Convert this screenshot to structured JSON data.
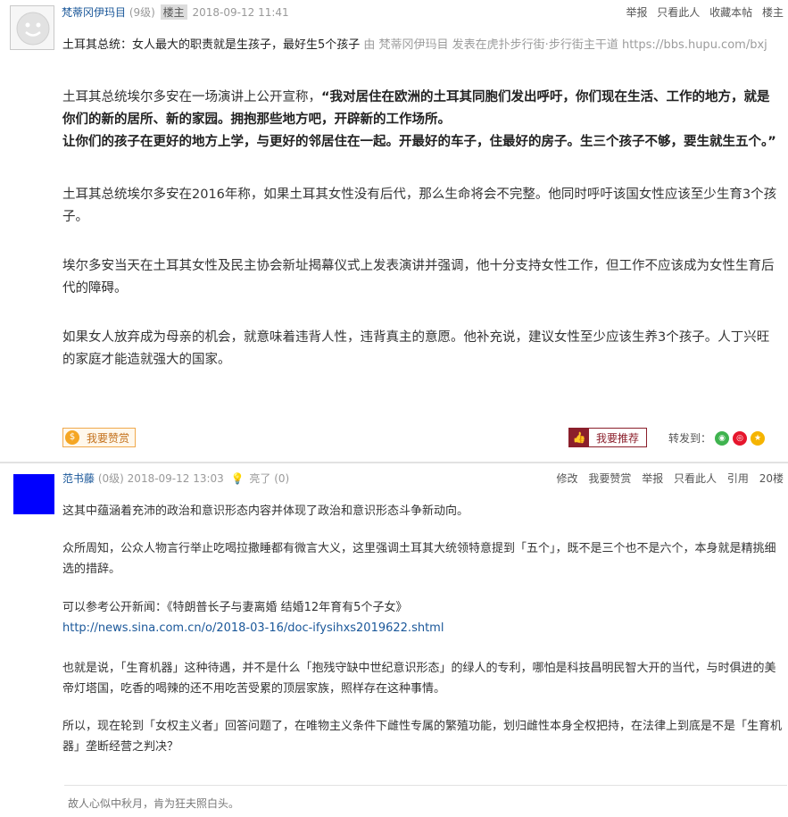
{
  "post1": {
    "username": "梵蒂冈伊玛目",
    "level": "(9级)",
    "badge": "楼主",
    "time": "2018-09-12 11:41",
    "actions": [
      "举报",
      "只看此人",
      "收藏本帖",
      "楼主"
    ],
    "title": "土耳其总统：女人最大的职责就是生孩子，最好生5个孩子",
    "source": "由 梵蒂冈伊玛目 发表在虎扑步行街·步行街主干道 https://bbs.hupu.com/bxj",
    "intro": "土耳其总统埃尔多安在一场演讲上公开宣称，",
    "quote_line1": "“我对居住在欧洲的土耳其同胞们发出呼吁，你们现在生活、工作的地方，就是你们的新的居所、新的家园。拥抱那些地方吧，开辟新的工作场所。",
    "quote_line2": "让你们的孩子在更好的地方上学，与更好的邻居住在一起。开最好的车子，住最好的房子。生三个孩子不够，要生就生五个。”",
    "para2": "土耳其总统埃尔多安在2016年称，如果土耳其女性没有后代，那么生命将会不完整。他同时呼吁该国女性应该至少生育3个孩子。",
    "para3": "埃尔多安当天在土耳其女性及民主协会新址揭幕仪式上发表演讲并强调，他十分支持女性工作，但工作不应该成为女性生育后代的障碍。",
    "para4": "如果女人放弃成为母亲的机会，就意味着违背人性，违背真主的意愿。他补充说，建议女性至少应该生养3个孩子。人丁兴旺的家庭才能造就强大的国家。",
    "zan_label": "我要赞赏",
    "tui_label": "我要推荐",
    "share_label": "转发到："
  },
  "post2": {
    "username": "范书藤",
    "level": "(0级)",
    "time": "2018-09-12 13:03",
    "liang": "亮了 (0)",
    "actions": [
      "修改",
      "我要赞赏",
      "举报",
      "只看此人",
      "引用",
      "20楼"
    ],
    "para1": "这其中蕴涵着充沛的政治和意识形态内容并体现了政治和意识形态斗争新动向。",
    "para2": "众所周知，公众人物言行举止吃喝拉撒睡都有微言大义，这里强调土耳其大统领特意提到「五个」，既不是三个也不是六个，本身就是精挑细选的措辞。",
    "para3": "可以参考公开新闻：《特朗普长子与妻离婚 结婚12年育有5个子女》",
    "link": "http://news.sina.com.cn/o/2018-03-16/doc-ifysihxs2019622.shtml",
    "para4": "也就是说，「生育机器」这种待遇，并不是什么「抱残守缺中世纪意识形态」的绿人的专利，哪怕是科技昌明民智大开的当代，与时俱进的美帝灯塔国，吃香的喝辣的还不用吃苦受累的顶层家族，照样存在这种事情。",
    "para5": "所以，现在轮到「女权主义者」回答问题了，在唯物主义条件下雌性专属的繁殖功能，划归雌性本身全权把持，在法律上到底是不是「生育机器」垄断经营之判决？",
    "signature": "故人心似中秋月，肯为狂夫照白头。"
  },
  "colors": {
    "link": "#1a5799",
    "avatar2": "#0000ff",
    "recommend": "#8b1f2b",
    "reward": "#f5a623"
  },
  "icons": [
    "default-avatar-icon",
    "coin-icon",
    "thumbs-up-icon",
    "wechat-icon",
    "weibo-icon",
    "qzone-icon",
    "lightbulb-icon"
  ]
}
